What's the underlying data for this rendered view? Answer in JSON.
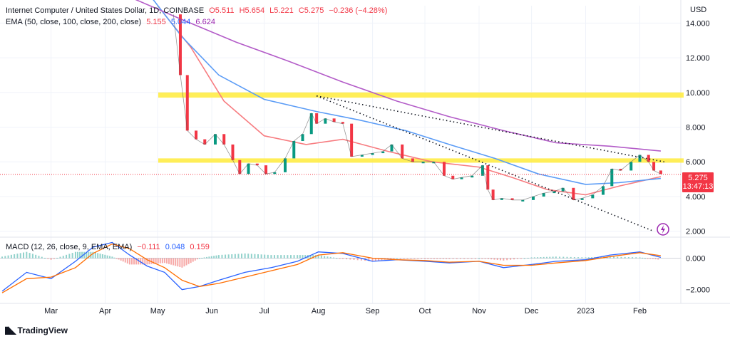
{
  "header": {
    "symbol": "Internet Computer / United States Dollar, 1D, COINBASE",
    "ohlc": {
      "o": "O5.511",
      "h": "H5.654",
      "l": "L5.221",
      "c": "C5.275",
      "chg": "−0.236 (−4.28%)"
    },
    "ema_label": "EMA (50, close, 100, close, 200, close)",
    "ema_values": {
      "ema50": "5.155",
      "ema100": "5.044",
      "ema200": "6.624"
    },
    "macd_label": "MACD (12, 26, close, 9, EMA, EMA)",
    "macd_values": {
      "hist": "−0.111",
      "macd": "0.048",
      "signal": "0.159"
    }
  },
  "price_axis": {
    "currency": "USD",
    "ticks": [
      "14.000",
      "12.000",
      "10.000",
      "8.000",
      "6.000",
      "4.000",
      "2.000"
    ]
  },
  "macd_axis": {
    "ticks": [
      "0.000",
      "−2.000"
    ]
  },
  "last_price": {
    "value": "5.275",
    "countdown": "13:47:13"
  },
  "time_axis": [
    "Mar",
    "Apr",
    "May",
    "Jun",
    "Jul",
    "Aug",
    "Sep",
    "Oct",
    "Nov",
    "Dec",
    "2023",
    "Feb"
  ],
  "brand": "TradingView",
  "colors": {
    "up": "#089981",
    "down": "#f23645",
    "ema50": "#f77c80",
    "ema100": "#5b9cf6",
    "ema200": "#b35cc8",
    "zone": "#ffeb3b",
    "macd": "#2962ff",
    "signal": "#ff6d00"
  },
  "chart_data": {
    "type": "line",
    "title": "Internet Computer / United States Dollar, 1D, COINBASE",
    "ylim": [
      1.7,
      15.0
    ],
    "macd_ylim": [
      -2.6,
      1.2
    ],
    "zones": [
      {
        "low": 9.7,
        "high": 10.0
      },
      {
        "low": 5.95,
        "high": 6.2
      }
    ],
    "trendlines": [
      {
        "from": [
          "2022-07-31",
          9.8
        ],
        "to": [
          "2023-02-15",
          6.0
        ]
      },
      {
        "from": [
          "2022-07-31",
          9.8
        ],
        "to": [
          "2023-02-09",
          2.0
        ]
      }
    ],
    "close_series": {
      "x": [
        "2022-05-10",
        "2022-05-14",
        "2022-05-18",
        "2022-05-23",
        "2022-05-28",
        "2022-06-03",
        "2022-06-08",
        "2022-06-13",
        "2022-06-17",
        "2022-06-22",
        "2022-06-27",
        "2022-07-02",
        "2022-07-07",
        "2022-07-13",
        "2022-07-18",
        "2022-07-23",
        "2022-07-28",
        "2022-07-31",
        "2022-08-05",
        "2022-08-10",
        "2022-08-15",
        "2022-08-20",
        "2022-08-26",
        "2022-09-01",
        "2022-09-07",
        "2022-09-12",
        "2022-09-18",
        "2022-09-24",
        "2022-09-30",
        "2022-10-06",
        "2022-10-12",
        "2022-10-17",
        "2022-10-22",
        "2022-10-28",
        "2022-11-03",
        "2022-11-06",
        "2022-11-09",
        "2022-11-14",
        "2022-11-20",
        "2022-11-26",
        "2022-12-02",
        "2022-12-08",
        "2022-12-14",
        "2022-12-19",
        "2022-12-25",
        "2022-12-30",
        "2023-01-05",
        "2023-01-11",
        "2023-01-16",
        "2023-01-21",
        "2023-01-27",
        "2023-02-01",
        "2023-02-06",
        "2023-02-09",
        "2023-02-13"
      ],
      "y": [
        14.5,
        11.0,
        7.8,
        7.3,
        7.0,
        7.6,
        7.0,
        6.1,
        5.3,
        5.9,
        5.8,
        5.3,
        5.4,
        6.2,
        7.2,
        7.6,
        8.8,
        8.2,
        8.5,
        8.3,
        8.2,
        6.3,
        6.4,
        6.5,
        6.6,
        7.0,
        6.2,
        6.0,
        6.0,
        6.0,
        5.2,
        5.0,
        5.1,
        5.2,
        5.8,
        4.4,
        3.8,
        3.9,
        3.8,
        3.8,
        4.0,
        4.2,
        4.3,
        4.5,
        3.8,
        3.9,
        4.1,
        4.6,
        5.6,
        5.5,
        6.0,
        6.4,
        6.0,
        5.5,
        5.3
      ]
    },
    "ema_series": [
      {
        "name": "EMA 50",
        "x": [
          "2022-05-01",
          "2022-05-20",
          "2022-06-08",
          "2022-07-01",
          "2022-07-25",
          "2022-08-15",
          "2022-09-10",
          "2022-10-05",
          "2022-11-01",
          "2022-11-20",
          "2022-12-10",
          "2023-01-01",
          "2023-01-20",
          "2023-02-13"
        ],
        "y": [
          15.0,
          12.6,
          9.5,
          7.5,
          7.0,
          7.3,
          6.6,
          6.0,
          5.7,
          5.1,
          4.4,
          4.1,
          4.6,
          5.15
        ]
      },
      {
        "name": "EMA 100",
        "x": [
          "2022-04-01",
          "2022-04-25",
          "2022-05-15",
          "2022-06-05",
          "2022-07-01",
          "2022-07-31",
          "2022-08-25",
          "2022-09-20",
          "2022-10-15",
          "2022-11-10",
          "2022-12-05",
          "2023-01-01",
          "2023-01-20",
          "2023-02-13"
        ],
        "y": [
          17.0,
          15.8,
          13.2,
          11.0,
          9.6,
          8.9,
          8.4,
          7.8,
          7.0,
          6.2,
          5.3,
          4.7,
          4.8,
          5.04
        ]
      },
      {
        "name": "EMA 200",
        "x": [
          "2022-04-15",
          "2022-05-15",
          "2022-06-15",
          "2022-07-15",
          "2022-08-15",
          "2022-09-15",
          "2022-10-15",
          "2022-11-15",
          "2022-12-15",
          "2023-01-15",
          "2023-02-13"
        ],
        "y": [
          15.5,
          14.2,
          12.9,
          11.8,
          10.6,
          9.5,
          8.6,
          7.8,
          7.1,
          6.9,
          6.62
        ]
      }
    ],
    "macd_series": [
      {
        "name": "MACD",
        "x": [
          "2022-02-01",
          "2022-02-15",
          "2022-03-01",
          "2022-03-15",
          "2022-03-25",
          "2022-04-05",
          "2022-04-15",
          "2022-04-25",
          "2022-05-05",
          "2022-05-15",
          "2022-05-25",
          "2022-06-05",
          "2022-06-20",
          "2022-07-05",
          "2022-07-20",
          "2022-08-01",
          "2022-08-15",
          "2022-09-01",
          "2022-09-15",
          "2022-10-01",
          "2022-10-15",
          "2022-11-01",
          "2022-11-15",
          "2022-12-01",
          "2022-12-15",
          "2023-01-01",
          "2023-01-15",
          "2023-02-01",
          "2023-02-13"
        ],
        "y": [
          -2.1,
          -0.9,
          -1.3,
          -0.2,
          0.7,
          1.0,
          0.2,
          -0.5,
          -0.9,
          -2.0,
          -1.8,
          -1.4,
          -0.9,
          -0.6,
          -0.2,
          0.4,
          0.3,
          -0.2,
          -0.1,
          -0.2,
          -0.3,
          -0.2,
          -0.6,
          -0.4,
          -0.2,
          -0.1,
          0.2,
          0.4,
          0.05
        ]
      },
      {
        "name": "Signal",
        "x": [
          "2022-02-01",
          "2022-02-15",
          "2022-03-01",
          "2022-03-15",
          "2022-03-25",
          "2022-04-05",
          "2022-04-15",
          "2022-04-25",
          "2022-05-05",
          "2022-05-15",
          "2022-05-25",
          "2022-06-05",
          "2022-06-20",
          "2022-07-05",
          "2022-07-20",
          "2022-08-01",
          "2022-08-15",
          "2022-09-01",
          "2022-09-15",
          "2022-10-01",
          "2022-10-15",
          "2022-11-01",
          "2022-11-15",
          "2022-12-01",
          "2022-12-15",
          "2023-01-01",
          "2023-01-15",
          "2023-02-01",
          "2023-02-13"
        ],
        "y": [
          -2.2,
          -1.3,
          -1.2,
          -0.6,
          0.3,
          0.9,
          0.6,
          -0.1,
          -0.6,
          -1.4,
          -1.8,
          -1.6,
          -1.2,
          -0.8,
          -0.4,
          0.2,
          0.35,
          0.0,
          -0.1,
          -0.15,
          -0.25,
          -0.2,
          -0.45,
          -0.45,
          -0.3,
          -0.15,
          0.1,
          0.35,
          0.16
        ]
      }
    ]
  }
}
